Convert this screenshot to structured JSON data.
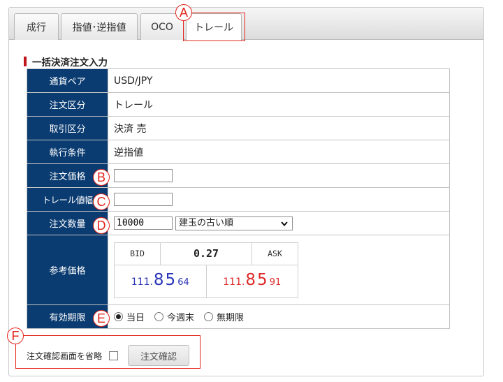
{
  "tabs": [
    {
      "label": "成行"
    },
    {
      "label": "指値･逆指値"
    },
    {
      "label": "OCO"
    },
    {
      "label": "トレール"
    }
  ],
  "active_tab": "トレール",
  "section_title": "一括決済注文入力",
  "rows": {
    "pair": {
      "label": "通貨ペア",
      "value": "USD/JPY"
    },
    "order_type": {
      "label": "注文区分",
      "value": "トレール"
    },
    "trade_type": {
      "label": "取引区分",
      "value": "決済 売"
    },
    "exec_condition": {
      "label": "執行条件",
      "value": "逆指値"
    },
    "order_price": {
      "label": "注文価格",
      "value": ""
    },
    "trail_width": {
      "label": "トレール値幅",
      "value": ""
    },
    "quantity": {
      "label": "注文数量",
      "value": "10000",
      "sort_option": "建玉の古い順"
    },
    "reference_price": {
      "label": "参考価格"
    },
    "expiry": {
      "label": "有効期限",
      "options": [
        "当日",
        "今週末",
        "無期限"
      ],
      "selected": "当日"
    }
  },
  "quote": {
    "bid_label": "BID",
    "ask_label": "ASK",
    "spread": "0.27",
    "bid": {
      "head": "111.",
      "big": "85",
      "pip": "64"
    },
    "ask": {
      "head": "111.",
      "big": "85",
      "pip": "91"
    }
  },
  "skip_confirm_label": "注文確認画面を省略",
  "skip_confirm_checked": false,
  "confirm_button": "注文確認",
  "callouts": {
    "a": "A",
    "b": "B",
    "c": "C",
    "d": "D",
    "e": "E",
    "f": "F"
  },
  "colors": {
    "header_cell": "#0b3c71",
    "bid": "#2a35b8",
    "ask": "#dd2a2a",
    "callout": "#e3241b",
    "title_bar": "#c0151a"
  }
}
